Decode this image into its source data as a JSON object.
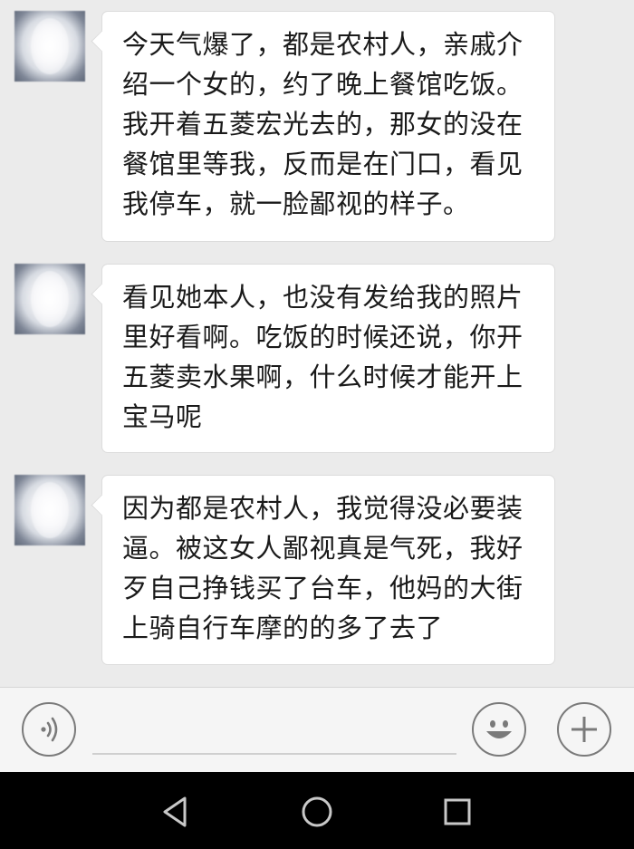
{
  "messages": [
    {
      "sender": "other",
      "text": "今天气爆了，都是农村人，亲戚介绍一个女的，约了晚上餐馆吃饭。我开着五菱宏光去的，那女的没在餐馆里等我，反而是在门口，看见我停车，就一脸鄙视的样子。"
    },
    {
      "sender": "other",
      "text": "看见她本人，也没有发给我的照片里好看啊。吃饭的时候还说，你开五菱卖水果啊，什么时候才能开上宝马呢"
    },
    {
      "sender": "other",
      "text": "因为都是农村人，我觉得没必要装逼。被这女人鄙视真是气死，我好歹自己挣钱买了台车，他妈的大街上骑自行车摩的的多了去了"
    }
  ],
  "input_bar": {
    "voice_icon": "voice-icon",
    "emoji_icon": "emoji-icon",
    "more_icon": "plus-icon",
    "text_value": ""
  },
  "nav_bar": {
    "back_icon": "triangle-back-icon",
    "home_icon": "circle-home-icon",
    "recent_icon": "square-recent-icon"
  },
  "colors": {
    "chat_background": "#ebebeb",
    "bubble_background": "#ffffff",
    "text": "#1a1a1a",
    "input_bar_background": "#f5f5f5",
    "nav_bar_background": "#000000"
  }
}
